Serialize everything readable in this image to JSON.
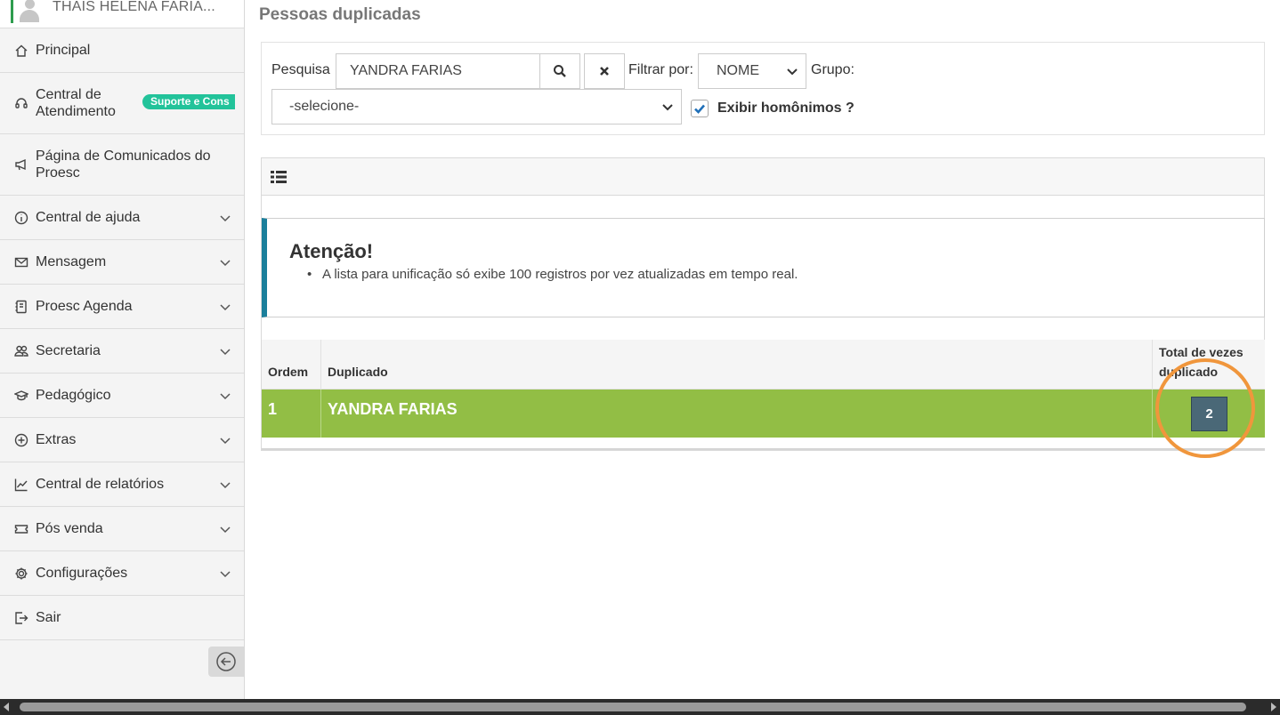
{
  "user": {
    "name": "THAIS HELENA FARIA..."
  },
  "sidebar": {
    "items": [
      {
        "label": "Principal",
        "icon": "home-icon",
        "has_chevron": false
      },
      {
        "label": "Central de Atendimento",
        "icon": "headset-icon",
        "badge": "Suporte e Cons",
        "has_chevron": false
      },
      {
        "label": "Página de Comunicados do Proesc",
        "icon": "megaphone-icon",
        "has_chevron": false
      },
      {
        "label": "Central de ajuda",
        "icon": "info-icon",
        "has_chevron": true
      },
      {
        "label": "Mensagem",
        "icon": "envelope-icon",
        "has_chevron": true
      },
      {
        "label": "Proesc Agenda",
        "icon": "agenda-icon",
        "has_chevron": true
      },
      {
        "label": "Secretaria",
        "icon": "people-icon",
        "has_chevron": true
      },
      {
        "label": "Pedagógico",
        "icon": "graduation-cap-icon",
        "has_chevron": true
      },
      {
        "label": "Extras",
        "icon": "plus-circle-icon",
        "has_chevron": true
      },
      {
        "label": "Central de relatórios",
        "icon": "line-chart-icon",
        "has_chevron": true
      },
      {
        "label": "Pós venda",
        "icon": "ticket-icon",
        "has_chevron": true
      },
      {
        "label": "Configurações",
        "icon": "gear-icon",
        "has_chevron": true
      },
      {
        "label": "Sair",
        "icon": "logout-icon",
        "has_chevron": false
      }
    ],
    "collapse_icon": "arrow-left-circle-icon"
  },
  "page": {
    "title": "Pessoas duplicadas"
  },
  "filters": {
    "search_label": "Pesquisa",
    "search_value": "YANDRA FARIAS",
    "filter_by_label": "Filtrar por:",
    "filter_by_value": "NOME",
    "group_label": "Grupo:",
    "group_value": "-selecione-",
    "show_homonyms_label": "Exibir homônimos ?",
    "show_homonyms_checked": true
  },
  "alert": {
    "title": "Atenção!",
    "items": [
      "A lista para unificação só exibe 100 registros por vez atualizadas em tempo real."
    ]
  },
  "table": {
    "headers": [
      "Ordem",
      "Duplicado",
      "Total de vezes duplicado"
    ],
    "rows": [
      {
        "order": "1",
        "name": "YANDRA FARIAS",
        "count": "2"
      }
    ]
  },
  "colors": {
    "row_highlight": "#92be45",
    "alert_accent": "#1b7f9b",
    "badge": "#22c39a",
    "annotation_circle": "#f0963c",
    "count_button": "#4a6877"
  }
}
